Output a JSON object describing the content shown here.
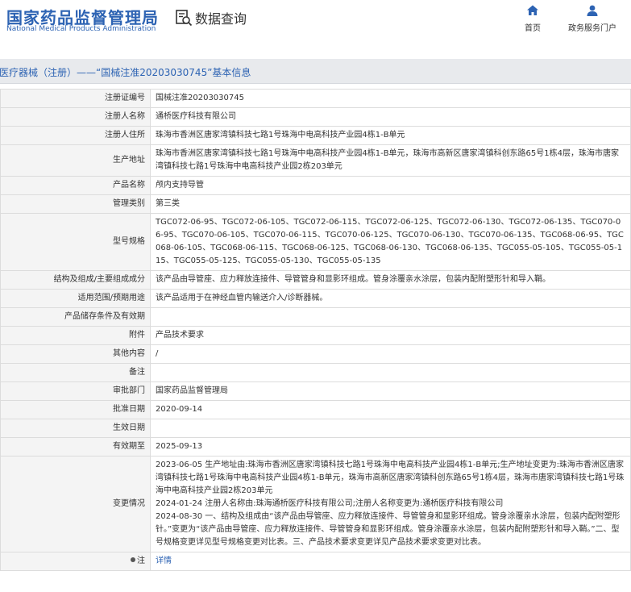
{
  "header": {
    "logo_cn": "国家药品监督管理局",
    "logo_en": "National Medical Products Administration",
    "query_label": "数据查询",
    "nav_home": "首页",
    "nav_services": "政务服务门户",
    "brand_color": "#2d63b3"
  },
  "breadcrumb": "医疗器械（注册）——“国械注准20203030745”基本信息",
  "rows": [
    {
      "label": "注册证编号",
      "value": "国械注准20203030745"
    },
    {
      "label": "注册人名称",
      "value": "通桥医疗科技有限公司"
    },
    {
      "label": "注册人住所",
      "value": "珠海市香洲区唐家湾镇科技七路1号珠海中电高科技产业园4栋1-B单元"
    },
    {
      "label": "生产地址",
      "value": "珠海市香洲区唐家湾镇科技七路1号珠海中电高科技产业园4栋1-B单元，珠海市高新区唐家湾镇科创东路65号1栋4层，珠海市唐家湾镇科技七路1号珠海中电高科技产业园2栋203单元"
    },
    {
      "label": "产品名称",
      "value": "颅内支持导管"
    },
    {
      "label": "管理类别",
      "value": "第三类"
    },
    {
      "label": "型号规格",
      "value": "TGC072-06-95、TGC072-06-105、TGC072-06-115、TGC072-06-125、TGC072-06-130、TGC072-06-135、TGC070-06-95、TGC070-06-105、TGC070-06-115、TGC070-06-125、TGC070-06-130、TGC070-06-135、TGC068-06-95、TGC068-06-105、TGC068-06-115、TGC068-06-125、TGC068-06-130、TGC068-06-135、TGC055-05-105、TGC055-05-115、TGC055-05-125、TGC055-05-130、TGC055-05-135"
    },
    {
      "label": "结构及组成/主要组成成分",
      "value": "该产品由导管座、应力释放连接件、导管管身和显影环组成。管身涂覆亲水涂层，包装内配附塑形针和导入鞘。"
    },
    {
      "label": "适用范围/预期用途",
      "value": "该产品适用于在神经血管内输送介入/诊断器械。"
    },
    {
      "label": "产品储存条件及有效期",
      "value": ""
    },
    {
      "label": "附件",
      "value": "产品技术要求"
    },
    {
      "label": "其他内容",
      "value": "/"
    },
    {
      "label": "备注",
      "value": ""
    },
    {
      "label": "审批部门",
      "value": "国家药品监督管理局"
    },
    {
      "label": "批准日期",
      "value": "2020-09-14"
    },
    {
      "label": "生效日期",
      "value": ""
    },
    {
      "label": "有效期至",
      "value": "2025-09-13"
    }
  ],
  "changes": {
    "label": "变更情况",
    "lines": [
      "2023-06-05 生产地址由:珠海市香洲区唐家湾镇科技七路1号珠海中电高科技产业园4栋1-B单元;生产地址变更为:珠海市香洲区唐家湾镇科技七路1号珠海中电高科技产业园4栋1-B单元，珠海市高新区唐家湾镇科创东路65号1栋4层，珠海市唐家湾镇科技七路1号珠海中电高科技产业园2栋203单元",
      "2024-01-24 注册人名称由:珠海通桥医疗科技有限公司;注册人名称变更为:通桥医疗科技有限公司",
      "2024-08-30 一、结构及组成由“该产品由导管座、应力释放连接件、导管管身和显影环组成。管身涂覆亲水涂层，包装内配附塑形针。”变更为“该产品由导管座、应力释放连接件、导管管身和显影环组成。管身涂覆亲水涂层，包装内配附塑形针和导入鞘。”二、型号规格变更详见型号规格变更对比表。三、产品技术要求变更详见产品技术要求变更对比表。"
    ]
  },
  "note": {
    "label": "注",
    "link": "详情"
  }
}
